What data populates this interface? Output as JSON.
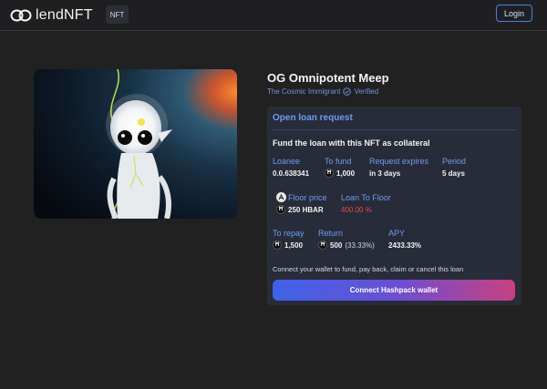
{
  "header": {
    "logo_text": "lendNFT",
    "nft_badge": "NFT",
    "login_label": "Login"
  },
  "nft": {
    "title": "OG Omnipotent Meep",
    "collection": "The Cosmic Immigrant",
    "verified_label": "Verified"
  },
  "loan": {
    "header": "Open loan request",
    "fund_text": "Fund the loan with this NFT as collateral",
    "loanee_label": "Loanee",
    "loanee_value": "0.0.638341",
    "to_fund_label": "To fund",
    "to_fund_value": "1,000",
    "expires_label": "Request expires",
    "expires_value": "in 3 days",
    "period_label": "Period",
    "period_value": "5 days",
    "floor_label": "Floor price",
    "floor_value": "250 HBAR",
    "ltf_label": "Loan To Floor",
    "ltf_value": "400.00 %",
    "repay_label": "To repay",
    "repay_value": "1,500",
    "return_label": "Return",
    "return_value": "500",
    "return_pct": "(33.33%)",
    "apy_label": "APY",
    "apy_value": "2433.33%",
    "connect_text": "Connect your wallet to fund, pay back, claim or cancel this loan",
    "connect_button": "Connect Hashpack wallet"
  },
  "colors": {
    "accent": "#6f9bec",
    "danger": "#e14a4a",
    "background": "#212122"
  },
  "icons": {
    "logo": "link-logo-icon",
    "verified": "verified-check-icon",
    "currency": "hbar-icon",
    "floor": "floor-price-icon"
  }
}
